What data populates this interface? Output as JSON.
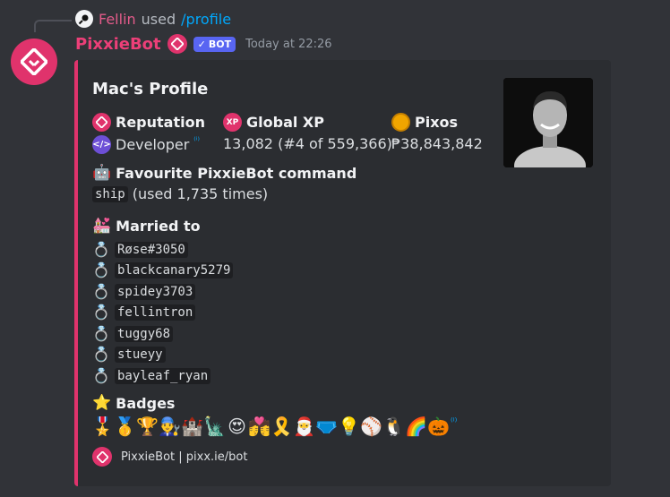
{
  "reply": {
    "user": "Fellin",
    "verb": "used",
    "command": "/profile"
  },
  "message": {
    "author": "PixxieBot",
    "bot_tag": "BOT",
    "timestamp": "Today at 22:26"
  },
  "embed": {
    "title": "Mac's Profile",
    "accent_color": "#e0336c",
    "fields": {
      "reputation": {
        "name": "Reputation",
        "value": "Developer"
      },
      "global_xp": {
        "name": "Global XP",
        "icon_text": "XP",
        "value": "13,082 (#4 of 559,366)"
      },
      "pixos": {
        "name": "Pixos",
        "value": "₱38,843,842"
      },
      "favourite_command": {
        "name": "Favourite PixxieBot command",
        "command": "ship",
        "usage": "(used 1,735 times)"
      },
      "married_to": {
        "name": "Married to",
        "spouses": [
          "Røse#3050",
          "blackcanary5279",
          "spidey3703",
          "fellintron",
          "tuggy68",
          "stueyy",
          "bayleaf_ryan"
        ]
      },
      "badges": {
        "name": "Badges",
        "items": [
          "🎖️",
          "🥇",
          "🏆",
          "👨‍🔧",
          "🏰",
          "🗽",
          "😍",
          "💏",
          "🎗️",
          "🎅",
          "🩲",
          "💡",
          "⚾",
          "🐧",
          "🌈",
          "🎃"
        ]
      }
    },
    "footer": "PixxieBot | pixx.ie/bot"
  },
  "icons": {
    "reply_avatar": "magnifier-icon",
    "bot_logo": "pixxiebot-logo",
    "reputation": "pixxiebot-logo",
    "developer": "code-icon",
    "xp": "xp-icon",
    "pixos": "coin-icon",
    "command": "robot-icon",
    "married": "wedding-icon",
    "ring": "ring-icon",
    "badges": "star-icon",
    "info": "info-icon"
  },
  "colors": {
    "brand": "#e0336c",
    "name": "#ec3f78",
    "link": "#00a8fc",
    "bot_tag": "#5865f2"
  }
}
